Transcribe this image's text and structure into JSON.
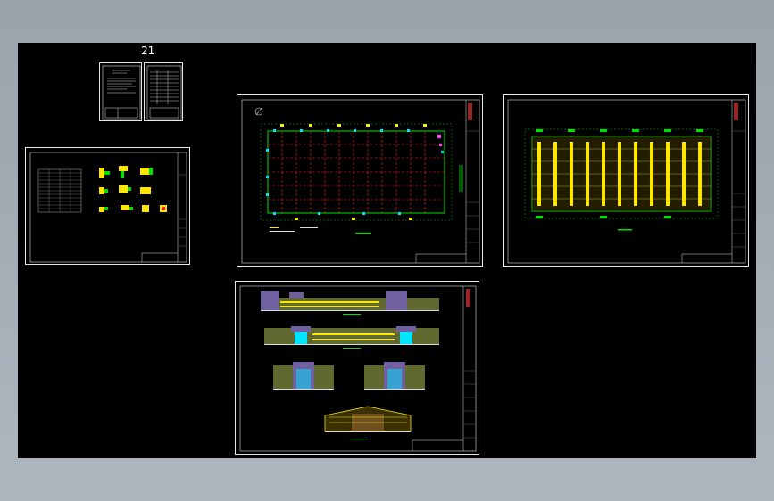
{
  "viewer": {
    "background_color": "#a1a9b1",
    "canvas_color": "#000000"
  },
  "drawing_set": {
    "sheet_index_label": "21",
    "colors": {
      "line_white": "#e8e8e8",
      "green": "#00e000",
      "red": "#ff2020",
      "yellow": "#ffe600",
      "cyan": "#00e5ff",
      "magenta": "#ff40ff",
      "purple": "#7060a0",
      "olive": "#a0a040"
    }
  }
}
